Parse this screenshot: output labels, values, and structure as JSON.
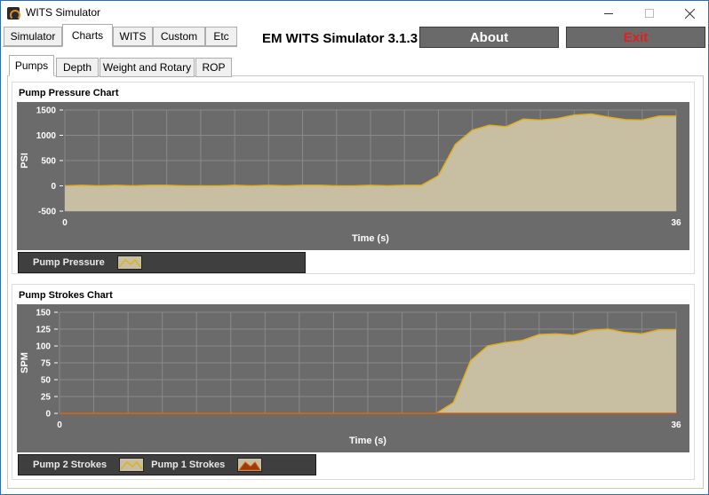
{
  "window": {
    "title": "WITS Simulator"
  },
  "top_tabs": [
    {
      "label": "Simulator",
      "active": false
    },
    {
      "label": "Charts",
      "active": true
    },
    {
      "label": "WITS",
      "active": false
    },
    {
      "label": "Custom",
      "active": false
    },
    {
      "label": "Etc",
      "active": false
    }
  ],
  "header": {
    "app_title": "EM WITS Simulator 3.1.3",
    "about_label": "About",
    "exit_label": "Exit"
  },
  "inner_tabs": [
    {
      "label": "Pumps",
      "active": true
    },
    {
      "label": "Depth",
      "active": false
    },
    {
      "label": "Weight and Rotary",
      "active": false
    },
    {
      "label": "ROP",
      "active": false
    }
  ],
  "colors": {
    "plot_bg": "#6b6b6b",
    "area_fill": "#c8bfa2",
    "line_gold": "#e0b020",
    "line_orange": "#d05a10",
    "grid": "#8a8a8a",
    "legend_bg": "#3f3f3f",
    "exit_red": "#e02020"
  },
  "chart_data": [
    {
      "type": "area",
      "title": "Pump Pressure Chart",
      "xlabel": "Time (s)",
      "ylabel": "PSI",
      "xlim": [
        0,
        36
      ],
      "ylim": [
        -500,
        1500
      ],
      "y_ticks": [
        -500,
        0,
        500,
        1000,
        1500
      ],
      "x_tick_labels": [
        "0",
        "36"
      ],
      "grid": true,
      "legend": "bottom-left",
      "legend_entries": [
        "Pump Pressure"
      ],
      "series": [
        {
          "name": "Pump Pressure",
          "x": [
            0,
            1,
            2,
            3,
            4,
            5,
            6,
            7,
            8,
            9,
            10,
            11,
            12,
            13,
            14,
            15,
            16,
            17,
            18,
            19,
            20,
            21,
            22,
            23,
            24,
            25,
            26,
            27,
            28,
            29,
            30,
            31,
            32,
            33,
            34,
            35,
            36
          ],
          "values": [
            0,
            10,
            0,
            10,
            0,
            10,
            10,
            0,
            0,
            0,
            10,
            0,
            10,
            0,
            10,
            10,
            0,
            0,
            10,
            0,
            10,
            10,
            200,
            820,
            1100,
            1200,
            1170,
            1320,
            1300,
            1330,
            1400,
            1420,
            1360,
            1310,
            1300,
            1380,
            1380
          ]
        }
      ]
    },
    {
      "type": "area",
      "title": "Pump Strokes Chart",
      "xlabel": "Time (s)",
      "ylabel": "SPM",
      "xlim": [
        0,
        36
      ],
      "ylim": [
        0,
        150
      ],
      "y_ticks": [
        0,
        25,
        50,
        75,
        100,
        125,
        150
      ],
      "x_tick_labels": [
        "0",
        "36"
      ],
      "grid": true,
      "legend": "bottom-left",
      "legend_entries": [
        "Pump 2 Strokes",
        "Pump 1 Strokes"
      ],
      "series": [
        {
          "name": "Pump 2 Strokes",
          "x": [
            0,
            1,
            2,
            3,
            4,
            5,
            6,
            7,
            8,
            9,
            10,
            11,
            12,
            13,
            14,
            15,
            16,
            17,
            18,
            19,
            20,
            21,
            22,
            23,
            24,
            25,
            26,
            27,
            28,
            29,
            30,
            31,
            32,
            33,
            34,
            35,
            36
          ],
          "values": [
            0,
            0,
            0,
            0,
            0,
            0,
            0,
            0,
            0,
            0,
            0,
            0,
            0,
            0,
            0,
            0,
            0,
            0,
            0,
            0,
            0,
            0,
            0,
            16,
            78,
            100,
            105,
            108,
            117,
            118,
            116,
            123,
            125,
            120,
            118,
            124,
            124
          ]
        },
        {
          "name": "Pump 1 Strokes",
          "x": [
            0,
            36
          ],
          "values": [
            0,
            0
          ]
        }
      ]
    }
  ]
}
